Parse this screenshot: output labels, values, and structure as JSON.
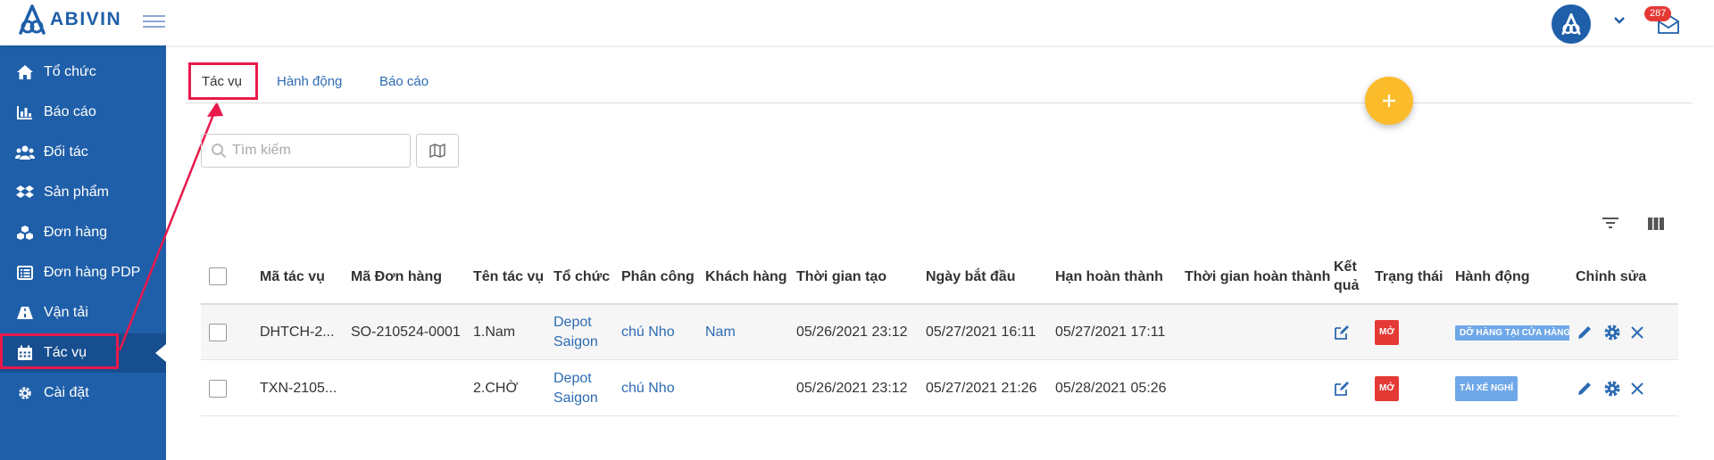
{
  "app": {
    "brand": "ABIVIN"
  },
  "header": {
    "notification_count": "287"
  },
  "sidebar": {
    "items": [
      {
        "label": "Tổ chức",
        "icon": "home-icon"
      },
      {
        "label": "Báo cáo",
        "icon": "bar-chart-icon"
      },
      {
        "label": "Đối tác",
        "icon": "users-icon"
      },
      {
        "label": "Sản phẩm",
        "icon": "dropbox-icon"
      },
      {
        "label": "Đơn hàng",
        "icon": "cubes-icon"
      },
      {
        "label": "Đơn hàng PDP",
        "icon": "list-alt-icon"
      },
      {
        "label": "Vận tải",
        "icon": "road-icon"
      },
      {
        "label": "Tác vụ",
        "icon": "calendar-icon",
        "active": true
      },
      {
        "label": "Cài đặt",
        "icon": "gear-icon"
      }
    ]
  },
  "tabs": [
    {
      "label": "Tác vụ",
      "active": true
    },
    {
      "label": "Hành động"
    },
    {
      "label": "Báo cáo"
    }
  ],
  "search": {
    "placeholder": "Tìm kiếm"
  },
  "table": {
    "columns": [
      "Mã tác vụ",
      "Mã Đơn hàng",
      "Tên tác vụ",
      "Tổ chức",
      "Phân công",
      "Khách hàng",
      "Thời gian tạo",
      "Ngày bắt đầu",
      "Hạn hoàn thành",
      "Thời gian hoàn thành",
      "Kết quả",
      "Trạng thái",
      "Hành động",
      "Chỉnh sửa"
    ],
    "rows": [
      {
        "task_code": "DHTCH-2...",
        "order_code": "SO-210524-0001",
        "task_name": "1.Nam",
        "org": "Depot Saigon",
        "assignee": "chú Nho",
        "customer": "Nam",
        "created": "05/26/2021 23:12",
        "start": "05/27/2021 16:11",
        "deadline": "05/27/2021 17:11",
        "completed": "",
        "status": "MỞ",
        "action": "DỠ HÀNG TẠI CỬA HÀNG"
      },
      {
        "task_code": "TXN-2105...",
        "order_code": "",
        "task_name": "2.CHỜ",
        "org": "Depot Saigon",
        "assignee": "chú Nho",
        "customer": "",
        "created": "05/26/2021 23:12",
        "start": "05/27/2021 21:26",
        "deadline": "05/28/2021 05:26",
        "completed": "",
        "status": "MỞ",
        "action": "TÀI XẾ NGHỈ"
      }
    ]
  },
  "colors": {
    "sidebar": "#1f5fa9",
    "accent": "#fbbc2b",
    "highlight": "#e8194b",
    "status_red": "#e53935",
    "action_blue": "#6fa8e8"
  }
}
